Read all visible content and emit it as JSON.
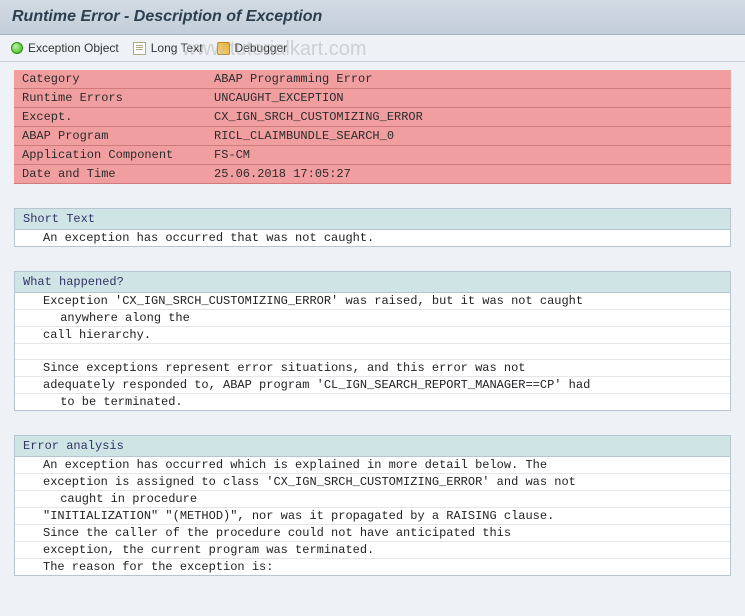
{
  "header": {
    "title": "Runtime Error - Description of Exception"
  },
  "toolbar": {
    "exception_label": "Exception Object",
    "longtext_label": "Long Text",
    "debugger_label": "Debugger"
  },
  "watermark": "www.tutorialkart.com",
  "rows": {
    "category_label": "Category",
    "category_value": "ABAP Programming Error",
    "runtime_label": "Runtime Errors",
    "runtime_value": "UNCAUGHT_EXCEPTION",
    "except_label": "Except.",
    "except_value": "CX_IGN_SRCH_CUSTOMIZING_ERROR",
    "abap_label": "ABAP Program",
    "abap_value": "RICL_CLAIMBUNDLE_SEARCH_0",
    "appcomp_label": "Application Component",
    "appcomp_value": "FS-CM",
    "datetime_label": "Date and Time",
    "datetime_value": "25.06.2018 17:05:27"
  },
  "short_text": {
    "title": "Short Text",
    "line1": "An exception has occurred that was not caught."
  },
  "what_happened": {
    "title": "What happened?",
    "line1": "Exception 'CX_IGN_SRCH_CUSTOMIZING_ERROR' was raised, but it was not caught",
    "line2": " anywhere along the",
    "line3": "call hierarchy.",
    "line4": "Since exceptions represent error situations, and this error was not",
    "line5": "adequately responded to, ABAP program 'CL_IGN_SEARCH_REPORT_MANAGER==CP' had",
    "line6": " to be terminated."
  },
  "error_analysis": {
    "title": "Error analysis",
    "line1": "An exception has occurred which is explained in more detail below. The",
    "line2": "exception is assigned to class 'CX_IGN_SRCH_CUSTOMIZING_ERROR' and was not",
    "line3": " caught in procedure",
    "line4": "\"INITIALIZATION\" \"(METHOD)\", nor was it propagated by a RAISING clause.",
    "line5": "Since the caller of the procedure could not have anticipated this",
    "line6": "exception, the current program was terminated.",
    "line7": "The reason for the exception is:"
  }
}
